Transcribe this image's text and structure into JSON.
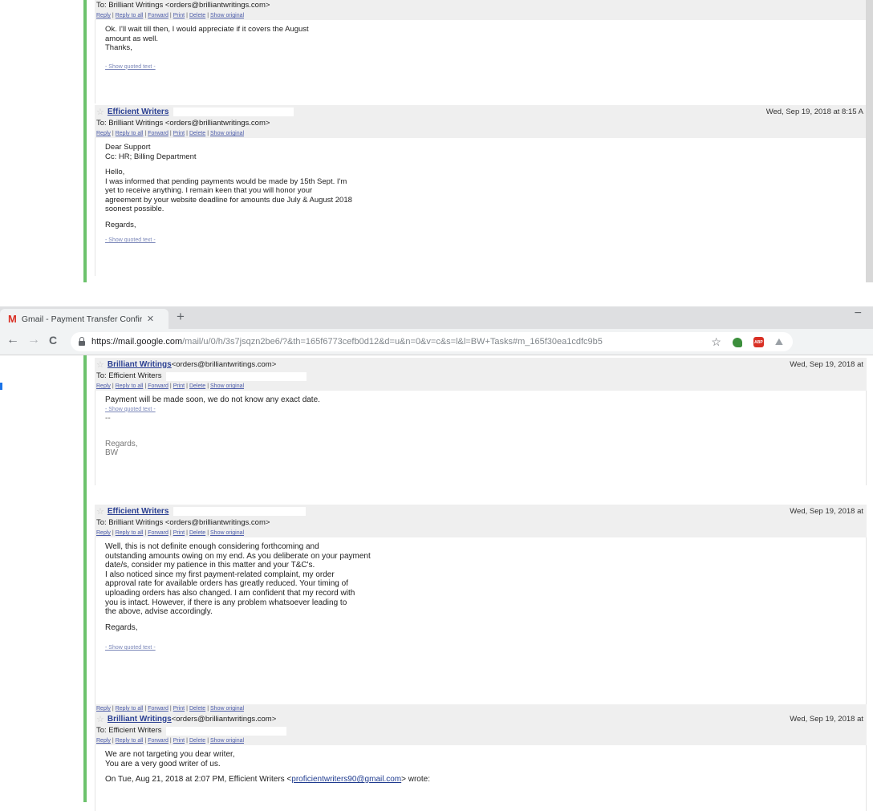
{
  "top_thread": {
    "msg1": {
      "to": "To: Brilliant Writings <orders@brilliantwritings.com>",
      "actions": [
        "Reply",
        "Reply to all",
        "Forward",
        "Print",
        "Delete",
        "Show original"
      ],
      "body": [
        "Ok. I'll wait till then, I would appreciate if it covers the August",
        "amount as well.",
        "Thanks,"
      ],
      "quoted": "- Show quoted text -"
    },
    "msg2": {
      "sender": "Efficient Writers",
      "date": "Wed, Sep 19, 2018 at 8:15 A",
      "to": "To: Brilliant Writings <orders@brilliantwritings.com>",
      "actions": [
        "Reply",
        "Reply to all",
        "Forward",
        "Print",
        "Delete",
        "Show original"
      ],
      "body_p1": [
        "Dear Support",
        "Cc: HR; Billing Department"
      ],
      "body_p2": [
        "Hello,",
        "I was informed that pending payments would be made by 15th Sept. I'm",
        "yet to receive anything. I remain keen that you will honor your",
        "agreement by your website deadline for amounts due July & August 2018",
        "soonest possible."
      ],
      "body_p3": "Regards,",
      "quoted": "- Show quoted text -"
    }
  },
  "browser": {
    "tab_title": "Gmail - Payment Transfer Confir",
    "tab_logo": "M",
    "tab_close": "✕",
    "newtab": "+",
    "minimize": "−",
    "back": "←",
    "forward": "→",
    "reload": "C",
    "url_host": "https://mail.google.com",
    "url_path": "/mail/u/0/h/3s7jsqzn2be6/?&th=165f6773cefb0d12&d=u&n=0&v=c&s=l&l=BW+Tasks#m_165f30ea1cdfc9b5",
    "star": "☆",
    "ext_abp": "ABP",
    "ext_last": "⛰"
  },
  "bottom_thread": {
    "msg1": {
      "sender": "Brilliant Writings",
      "sender_email": "<orders@brilliantwritings.com>",
      "date": "Wed, Sep 19, 2018 at",
      "to": "To: Efficient Writers",
      "actions": [
        "Reply",
        "Reply to all",
        "Forward",
        "Print",
        "Delete",
        "Show original"
      ],
      "body": "Payment will be made soon, we do not know any exact date.",
      "quoted": "- Show quoted text -",
      "sig_dash": "--",
      "sig": [
        "Regards,",
        "BW"
      ]
    },
    "msg2": {
      "sender": "Efficient Writers",
      "date": "Wed, Sep 19, 2018 at",
      "to": "To: Brilliant Writings <orders@brilliantwritings.com>",
      "actions": [
        "Reply",
        "Reply to all",
        "Forward",
        "Print",
        "Delete",
        "Show original"
      ],
      "body": [
        "Well, this is not definite enough considering forthcoming and",
        "outstanding amounts owing on my end. As you deliberate on your payment",
        "date/s, consider my patience in this matter and your T&C's.",
        "I also noticed since my first payment-related complaint, my order",
        "approval rate for available orders has greatly reduced. Your timing of",
        "uploading orders has also changed. I am confident that my record with",
        "you is intact. However, if there is any problem whatsoever leading to",
        "the above, advise accordingly."
      ],
      "regards": "Regards,",
      "quoted": "- Show quoted text -",
      "footer_actions": [
        "Reply",
        "Reply to all",
        "Forward",
        "Print",
        "Delete",
        "Show original"
      ]
    },
    "msg3": {
      "sender": "Brilliant Writings",
      "sender_email": "<orders@brilliantwritings.com>",
      "date": "Wed, Sep 19, 2018 at",
      "to": "To: Efficient Writers",
      "actions": [
        "Reply",
        "Reply to all",
        "Forward",
        "Print",
        "Delete",
        "Show original"
      ],
      "body": [
        "We are not targeting you dear writer,",
        "You are a very good writer of us."
      ],
      "quote_intro_pre": "On Tue, Aug 21, 2018 at 2:07 PM, Efficient Writers <",
      "quote_intro_link": "proficientwriters90@gmail.com",
      "quote_intro_post": "> wrote:"
    }
  }
}
